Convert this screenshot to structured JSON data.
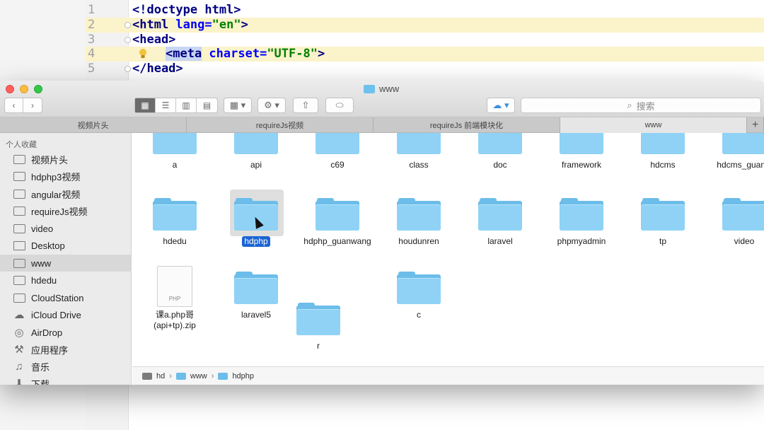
{
  "editor": {
    "lines": [
      {
        "num": "1",
        "t1": "<!doctype html>"
      },
      {
        "num": "2",
        "t1": "<html ",
        "t2": "lang=",
        "t3": "\"en\"",
        "t4": ">"
      },
      {
        "num": "3",
        "t1": "<head>"
      },
      {
        "num": "4",
        "t1": "<meta",
        "t2": " charset=",
        "t3": "\"UTF-8\"",
        "t4": ">"
      },
      {
        "num": "5",
        "t1": "</head>"
      }
    ]
  },
  "finder": {
    "title": "www",
    "search_placeholder": "搜索",
    "tabs": [
      "视频片头",
      "requireJs视频",
      "requireJs 前端模块化",
      "www"
    ],
    "tab_add": "+",
    "sidebar": {
      "header": "个人收藏",
      "items": [
        {
          "label": "视频片头",
          "icon": "folder-icon"
        },
        {
          "label": "hdphp3视频",
          "icon": "folder-icon"
        },
        {
          "label": "angular视频",
          "icon": "folder-icon"
        },
        {
          "label": "requireJs视频",
          "icon": "folder-icon"
        },
        {
          "label": "video",
          "icon": "folder-icon"
        },
        {
          "label": "Desktop",
          "icon": "desktop-icon"
        },
        {
          "label": "www",
          "icon": "folder-icon"
        },
        {
          "label": "hdedu",
          "icon": "folder-icon"
        },
        {
          "label": "CloudStation",
          "icon": "folder-icon"
        },
        {
          "label": "iCloud Drive",
          "icon": "cloud-icon"
        },
        {
          "label": "AirDrop",
          "icon": "airdrop-icon"
        },
        {
          "label": "应用程序",
          "icon": "apps-icon"
        },
        {
          "label": "音乐",
          "icon": "music-icon"
        },
        {
          "label": "下载",
          "icon": "download-icon"
        }
      ]
    },
    "row1": [
      "a",
      "api",
      "c69",
      "class",
      "doc",
      "framework",
      "hdcms",
      "hdcms_guanw"
    ],
    "row2": [
      "hdedu",
      "hdphp",
      "hdphp_guanwang",
      "houdunren",
      "laravel",
      "phpmyadmin",
      "tp",
      "video"
    ],
    "row3": {
      "file_name_line1": "课a.php哥",
      "file_name_line2": "(api+tp).zip",
      "file_badge": "PHP",
      "laravel5": "laravel5",
      "c": "c",
      "r": "r"
    },
    "path": [
      "hd",
      "www",
      "hdphp"
    ]
  }
}
